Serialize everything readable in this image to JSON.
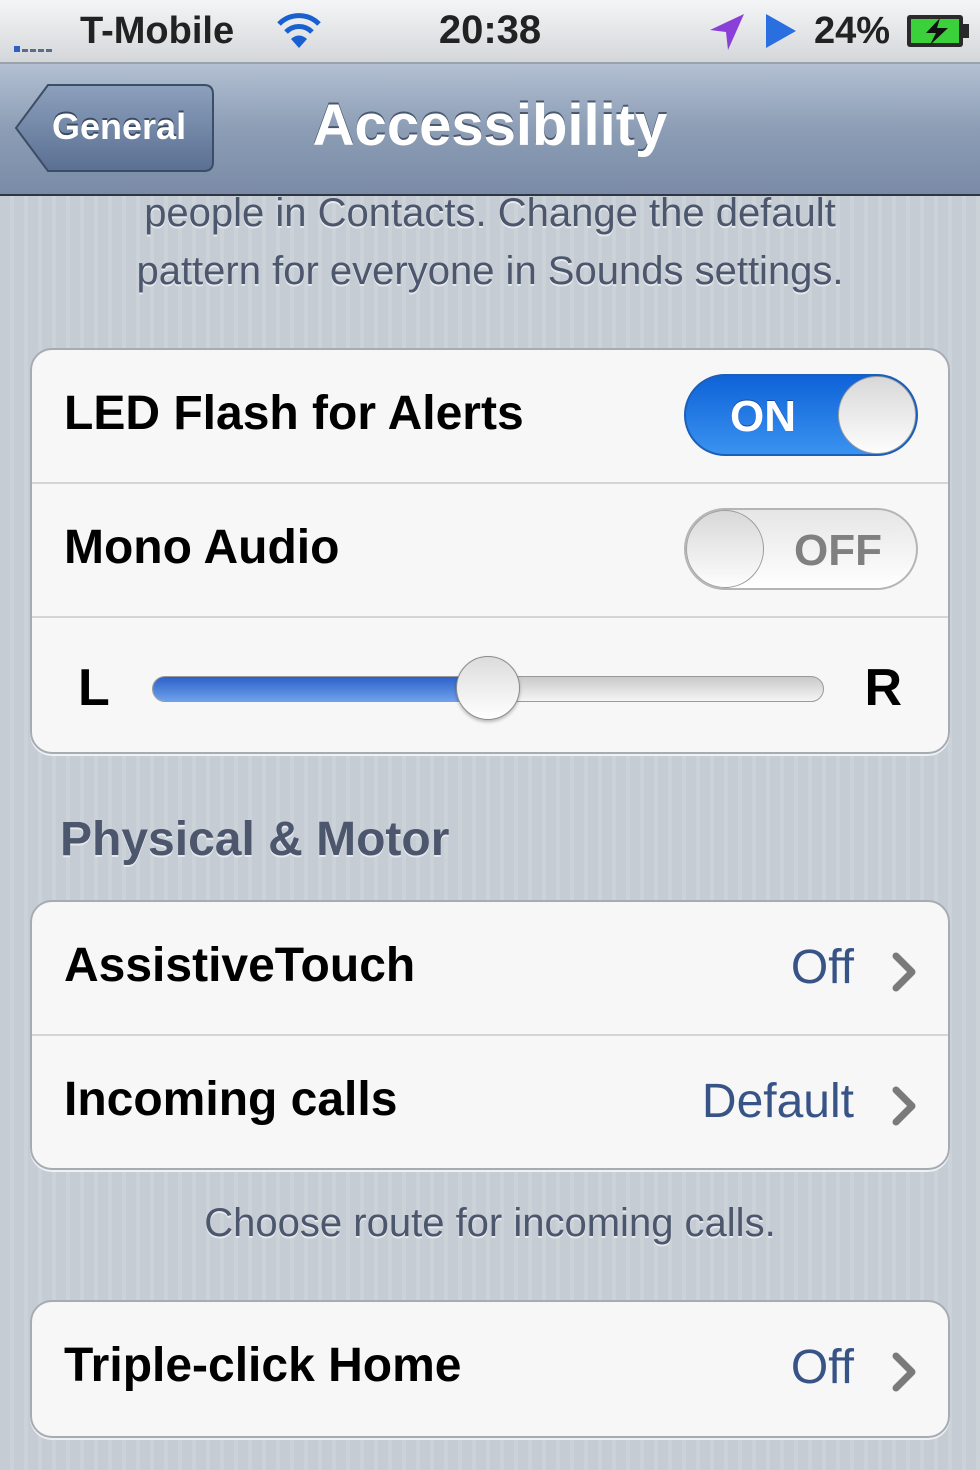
{
  "status_bar": {
    "carrier": "T-Mobile",
    "time": "20:38",
    "battery_percent": "24%"
  },
  "nav": {
    "back_label": "General",
    "title": "Accessibility"
  },
  "hearing_footer": {
    "line1": "people in Contacts. Change the default",
    "line2": "pattern for everyone in Sounds settings."
  },
  "hearing": {
    "led_flash": {
      "label": "LED Flash for Alerts",
      "state": "ON",
      "on": true
    },
    "mono_audio": {
      "label": "Mono Audio",
      "state": "OFF",
      "on": false
    },
    "balance": {
      "left_label": "L",
      "right_label": "R",
      "value": 0.5
    }
  },
  "physical_motor": {
    "header": "Physical & Motor",
    "items": [
      {
        "label": "AssistiveTouch",
        "value": "Off"
      },
      {
        "label": "Incoming calls",
        "value": "Default"
      }
    ],
    "footer": "Choose route for incoming calls."
  },
  "triple_click": {
    "label": "Triple-click Home",
    "value": "Off"
  },
  "colors": {
    "nav_bar": "#8c9db5",
    "value_text": "#385487",
    "toggle_on": "#1a6fe0",
    "background": "#c5ccd4"
  }
}
